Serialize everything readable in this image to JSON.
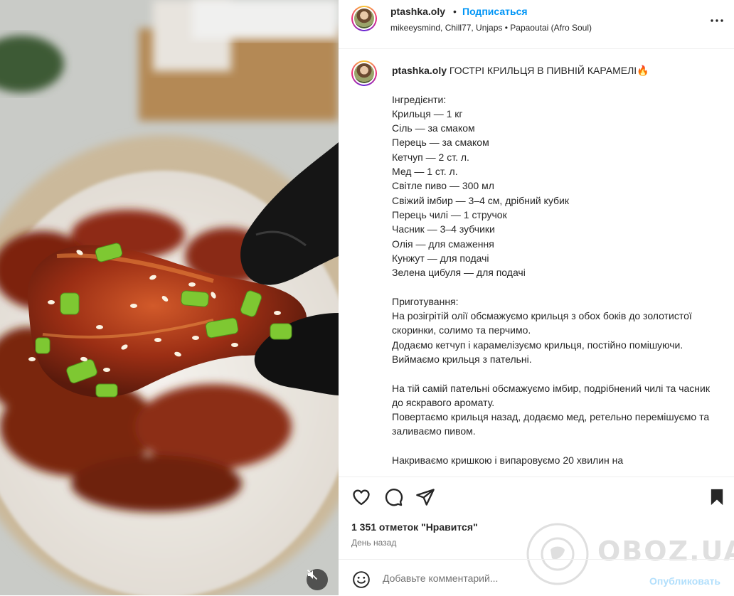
{
  "post": {
    "username": "ptashka.oly",
    "separator": "•",
    "follow_label": "Подписаться",
    "audio_line": "mikeeysmind, Chill77, Unjaps • Papaoutai (Afro Soul)",
    "caption": {
      "username": "ptashka.oly",
      "text": " ГОСТРІ КРИЛЬЦЯ В ПИВНІЙ КАРАМЕЛІ🔥\n\nІнгредієнти:\nКрильця — 1 кг\nСіль — за смаком\nПерець — за смаком\nКетчуп — 2 ст. л.\nМед — 1 ст. л.\nСвітле пиво — 300 мл\nСвіжий імбир — 3–4 см, дрібний кубик\nПерець чилі — 1 стручок\nЧасник — 3–4 зубчики\nОлія — для смаження\nКунжут — для подачі\nЗелена цибуля — для подачі\n\nПриготування:\nНа розігрітій олії обсмажуємо крильця з обох боків до золотистої скоринки, солимо та перчимо.\nДодаємо кетчуп і карамелізуємо крильця, постійно помішуючи.\nВиймаємо крильця з пательні.\n\nНа тій самій пательні обсмажуємо імбир, подрібнений чилі та часник до яскравого аромату.\nПовертаємо крильця назад, додаємо мед, ретельно перемішуємо та заливаємо пивом.\n\nНакриваємо кришкою і випаровуємо 20 хвилин на"
    },
    "likes": "1 351 отметок \"Нравится\"",
    "date": "День назад",
    "comment_placeholder": "Добавьте комментарий...",
    "publish_label": "Опубликовать"
  },
  "watermark": {
    "text": "OBOZ.UA"
  },
  "icons": {
    "more": "more-horizontal-icon",
    "like": "heart-icon",
    "comment": "comment-bubble-icon",
    "share": "paper-plane-icon",
    "save": "bookmark-icon",
    "emoji": "smiley-icon",
    "mute": "speaker-muted-icon"
  },
  "colors": {
    "link": "#0095f6",
    "publish_disabled": "#b2dffc",
    "text": "#262626",
    "muted": "#737373"
  }
}
